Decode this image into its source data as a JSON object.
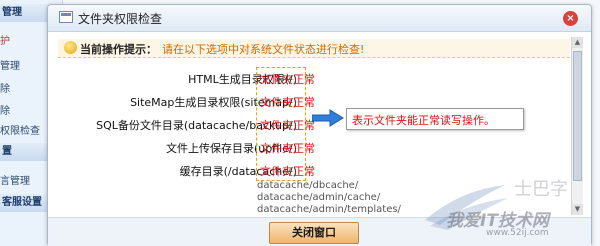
{
  "sidebar": {
    "items": [
      {
        "label": "管理",
        "kind": "header"
      },
      {
        "label": "护",
        "kind": "red"
      },
      {
        "label": "管理",
        "kind": "plain"
      },
      {
        "label": "除",
        "kind": "plain"
      },
      {
        "label": "除",
        "kind": "plain"
      },
      {
        "label": "权限检查",
        "kind": "plain"
      },
      {
        "label": "置",
        "kind": "header"
      },
      {
        "label": "言管理",
        "kind": "plain"
      },
      {
        "label": "客服设置",
        "kind": "header"
      }
    ]
  },
  "dialog": {
    "title": "文件夹权限检查",
    "close_glyph": "×",
    "notice_label": "当前操作提示：",
    "notice_text": "请在以下选项中对系统文件状态进行检查!",
    "rows": [
      {
        "label": "HTML生成目录权限(/)",
        "status": "文件夹正常"
      },
      {
        "label": "SiteMap生成目录权限(sitemap/)",
        "status": "文件夹正常"
      },
      {
        "label": "SQL备份文件目录(datacache/backup/)",
        "status": "文件夹正常"
      },
      {
        "label": "文件上传保存目录(upfile/)",
        "status": "文件夹正常"
      },
      {
        "label": "缓存目录(/datacache/)",
        "status": "文件夹正常"
      }
    ],
    "extra_paths": [
      "datacache/dbcache/",
      "datacache/admin/cache/",
      "datacache/admin/templates/"
    ],
    "tip_text": "表示文件夹能正常读写操作。",
    "close_window_label": "关闭窗口"
  },
  "watermark": {
    "cn": "我爱IT技术网",
    "url": "www.52ij.com",
    "corner": "士巴字"
  },
  "colors": {
    "status_red": "#dd1111",
    "notice_orange": "#d06a00",
    "box_orange": "#ff9a00",
    "arrow_blue": "#2f7fd8"
  }
}
